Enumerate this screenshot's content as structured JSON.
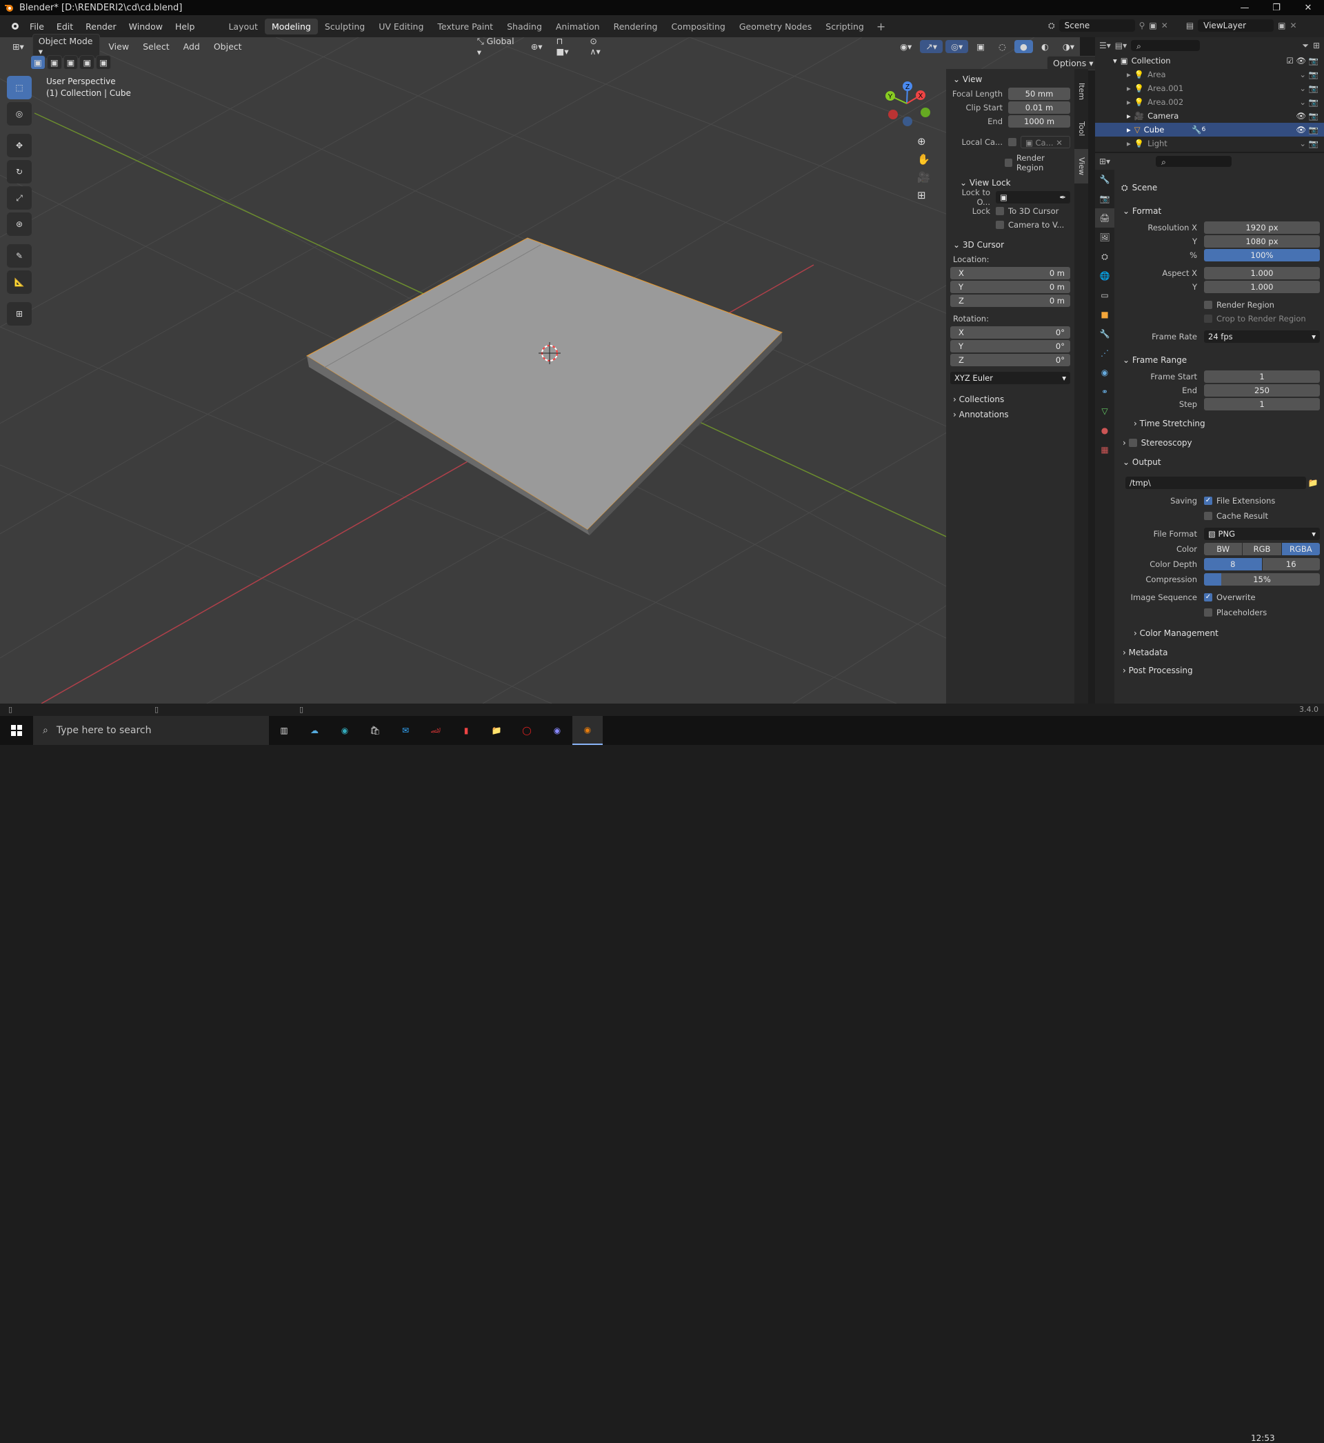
{
  "window": {
    "title": "Blender* [D:\\RENDERI2\\cd\\cd.blend]"
  },
  "menu": [
    "File",
    "Edit",
    "Render",
    "Window",
    "Help"
  ],
  "workspaces": [
    "Layout",
    "Modeling",
    "Sculpting",
    "UV Editing",
    "Texture Paint",
    "Shading",
    "Animation",
    "Rendering",
    "Compositing",
    "Geometry Nodes",
    "Scripting"
  ],
  "active_workspace": "Modeling",
  "scene": {
    "name": "Scene",
    "view_layer": "ViewLayer"
  },
  "viewport": {
    "mode": "Object Mode",
    "menus": [
      "View",
      "Select",
      "Add",
      "Object"
    ],
    "orientation": "Global",
    "options_label": "Options",
    "overlay_line1": "User Perspective",
    "overlay_line2": "(1) Collection | Cube",
    "gizmo": {
      "x": "X",
      "y": "Y",
      "z": "Z"
    }
  },
  "npanel": {
    "view_title": "View",
    "focal_length_label": "Focal Length",
    "focal_length": "50 mm",
    "clip_start_label": "Clip Start",
    "clip_start": "0.01 m",
    "end_label": "End",
    "end": "1000 m",
    "local_camera_label": "Local Ca...",
    "local_camera_value": "Ca...",
    "render_region_label": "Render Region",
    "view_lock_title": "View Lock",
    "lock_to_object_label": "Lock to O...",
    "lock_label": "Lock",
    "to_3d_cursor": "To 3D Cursor",
    "camera_to_view": "Camera to V...",
    "cursor_title": "3D Cursor",
    "location_label": "Location:",
    "loc_x": "0 m",
    "loc_y": "0 m",
    "loc_z": "0 m",
    "rotation_label": "Rotation:",
    "rot_x": "0°",
    "rot_y": "0°",
    "rot_z": "0°",
    "rotation_mode": "XYZ Euler",
    "collections_title": "Collections",
    "annotations_title": "Annotations",
    "x": "X",
    "y": "Y",
    "z": "Z",
    "tabs": [
      "Item",
      "Tool",
      "View"
    ]
  },
  "outliner": {
    "collection": "Collection",
    "items": [
      "Area",
      "Area.001",
      "Area.002",
      "Camera",
      "Cube",
      "Light"
    ],
    "cube_modifier_count": "6"
  },
  "properties": {
    "context": "Scene",
    "format_title": "Format",
    "res_x_label": "Resolution X",
    "res_x": "1920 px",
    "res_y_label": "Y",
    "res_y": "1080 px",
    "res_pct_label": "%",
    "res_pct": "100%",
    "aspect_x_label": "Aspect X",
    "aspect_x": "1.000",
    "aspect_y_label": "Y",
    "aspect_y": "1.000",
    "render_region": "Render Region",
    "crop_region": "Crop to Render Region",
    "frame_rate_label": "Frame Rate",
    "frame_rate": "24 fps",
    "frame_range_title": "Frame Range",
    "frame_start_label": "Frame Start",
    "frame_start": "1",
    "frame_end_label": "End",
    "frame_end": "250",
    "frame_step_label": "Step",
    "frame_step": "1",
    "time_stretching": "Time Stretching",
    "stereoscopy": "Stereoscopy",
    "output_title": "Output",
    "output_path": "/tmp\\",
    "saving_label": "Saving",
    "file_extensions": "File Extensions",
    "cache_result": "Cache Result",
    "file_format_label": "File Format",
    "file_format": "PNG",
    "color_label": "Color",
    "color_modes": [
      "BW",
      "RGB",
      "RGBA"
    ],
    "color_active": "RGBA",
    "color_depth_label": "Color Depth",
    "color_depths": [
      "8",
      "16"
    ],
    "compression_label": "Compression",
    "compression": "15%",
    "compression_fraction": 0.15,
    "image_sequence_label": "Image Sequence",
    "overwrite": "Overwrite",
    "placeholders": "Placeholders",
    "color_management": "Color Management",
    "metadata": "Metadata",
    "post_processing": "Post Processing"
  },
  "status": {
    "version": "3.4.0"
  },
  "taskbar": {
    "search_placeholder": "Type here to search",
    "time": "12:53"
  }
}
